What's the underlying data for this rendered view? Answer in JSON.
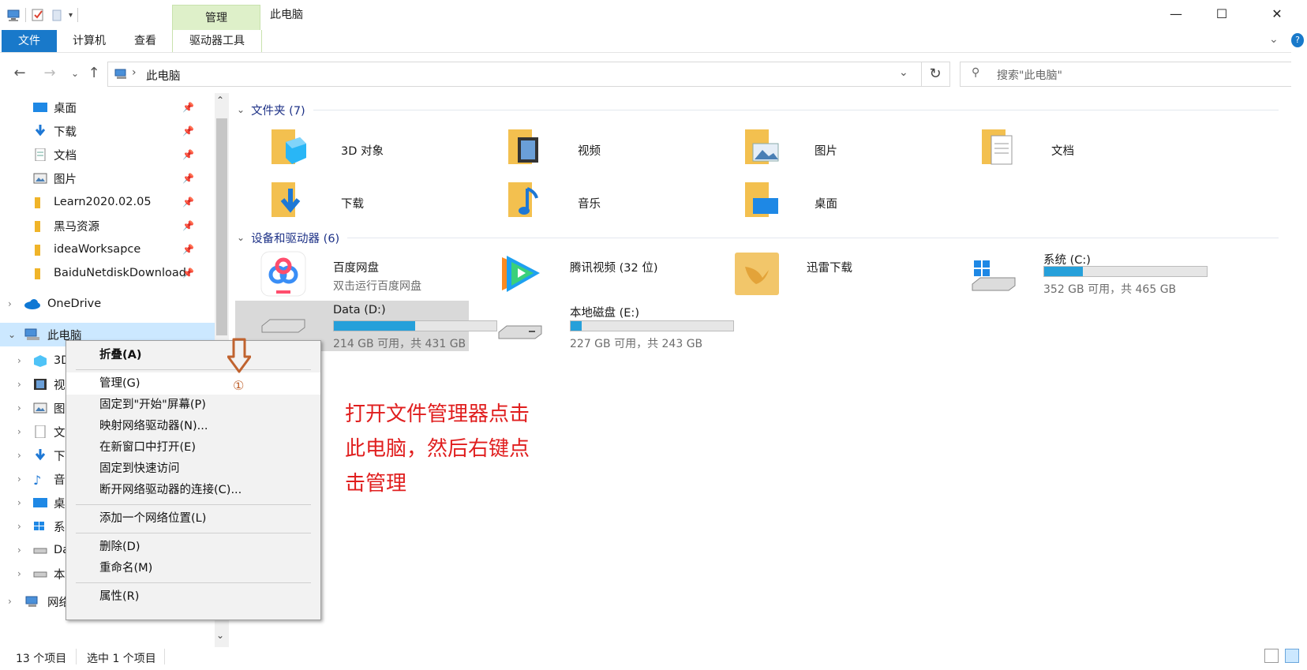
{
  "titlebar": {
    "context_tab": "管理",
    "window_title": "此电脑",
    "minimize": "—",
    "maximize": "☐",
    "close": "✕"
  },
  "ribbon": {
    "tabs": [
      "文件",
      "计算机",
      "查看",
      "驱动器工具"
    ]
  },
  "address": {
    "path": "此电脑",
    "search_placeholder": "搜索\"此电脑\""
  },
  "nav": {
    "quick_access": [
      {
        "label": "桌面",
        "icon": "desktop-icon",
        "pinned": true
      },
      {
        "label": "下载",
        "icon": "download-icon",
        "pinned": true
      },
      {
        "label": "文档",
        "icon": "documents-icon",
        "pinned": true
      },
      {
        "label": "图片",
        "icon": "pictures-icon",
        "pinned": true
      },
      {
        "label": "Learn2020.02.05",
        "icon": "folder-icon",
        "pinned": true
      },
      {
        "label": "黑马资源",
        "icon": "folder-icon",
        "pinned": true
      },
      {
        "label": "ideaWorksapce",
        "icon": "folder-icon",
        "pinned": true
      },
      {
        "label": "BaiduNetdiskDownload",
        "icon": "folder-icon",
        "pinned": true
      }
    ],
    "onedrive": "OneDrive",
    "this_pc": "此电脑",
    "pc_children": [
      "3D",
      "视",
      "图",
      "文",
      "下",
      "音",
      "桌",
      "系",
      "Da",
      "本"
    ],
    "network": "网络"
  },
  "content": {
    "folders_header": "文件夹 (7)",
    "folders": [
      {
        "name": "3D 对象",
        "icon": "3d-objects-folder-icon"
      },
      {
        "name": "视频",
        "icon": "videos-folder-icon"
      },
      {
        "name": "图片",
        "icon": "pictures-folder-icon"
      },
      {
        "name": "文档",
        "icon": "documents-folder-icon"
      },
      {
        "name": "下载",
        "icon": "downloads-folder-icon"
      },
      {
        "name": "音乐",
        "icon": "music-folder-icon"
      },
      {
        "name": "桌面",
        "icon": "desktop-folder-icon"
      }
    ],
    "devices_header": "设备和驱动器 (6)",
    "devices": [
      {
        "name": "百度网盘",
        "sub": "双击运行百度网盘",
        "icon": "baidu-netdisk-icon"
      },
      {
        "name": "腾讯视频 (32 位)",
        "sub": "",
        "icon": "tencent-video-icon"
      },
      {
        "name": "迅雷下载",
        "sub": "",
        "icon": "xunlei-folder-icon"
      },
      {
        "name": "系统 (C:)",
        "free": "352 GB 可用，共 465 GB",
        "used_fraction": 0.24,
        "icon": "windows-drive-icon"
      },
      {
        "name": "Data (D:)",
        "free": "214 GB 可用，共 431 GB",
        "used_fraction": 0.5,
        "icon": "hard-drive-icon"
      },
      {
        "name": "本地磁盘 (E:)",
        "free": "227 GB 可用，共 243 GB",
        "used_fraction": 0.07,
        "icon": "hard-drive-icon"
      }
    ]
  },
  "context_menu": {
    "items": [
      {
        "label": "折叠(A)",
        "bold": true
      },
      {
        "label": "管理(G)",
        "highlighted": true
      },
      {
        "label": "固定到\"开始\"屏幕(P)"
      },
      {
        "label": "映射网络驱动器(N)..."
      },
      {
        "label": "在新窗口中打开(E)"
      },
      {
        "label": "固定到快速访问"
      },
      {
        "label": "断开网络驱动器的连接(C)..."
      },
      {
        "label": "添加一个网络位置(L)"
      },
      {
        "label": "删除(D)"
      },
      {
        "label": "重命名(M)"
      },
      {
        "label": "属性(R)"
      }
    ],
    "step_marker": "①"
  },
  "annotation": {
    "lines": [
      "打开文件管理器点击",
      "此电脑，然后右键点",
      "击管理"
    ]
  },
  "status": {
    "count": "13 个项目",
    "selected": "选中 1 个项目"
  },
  "colors": {
    "accent": "#1979ca",
    "context_tab_bg": "#def0c9",
    "drive_bar": "#26a0da",
    "selection": "#cce8ff",
    "annotation": "#e01e1e"
  }
}
